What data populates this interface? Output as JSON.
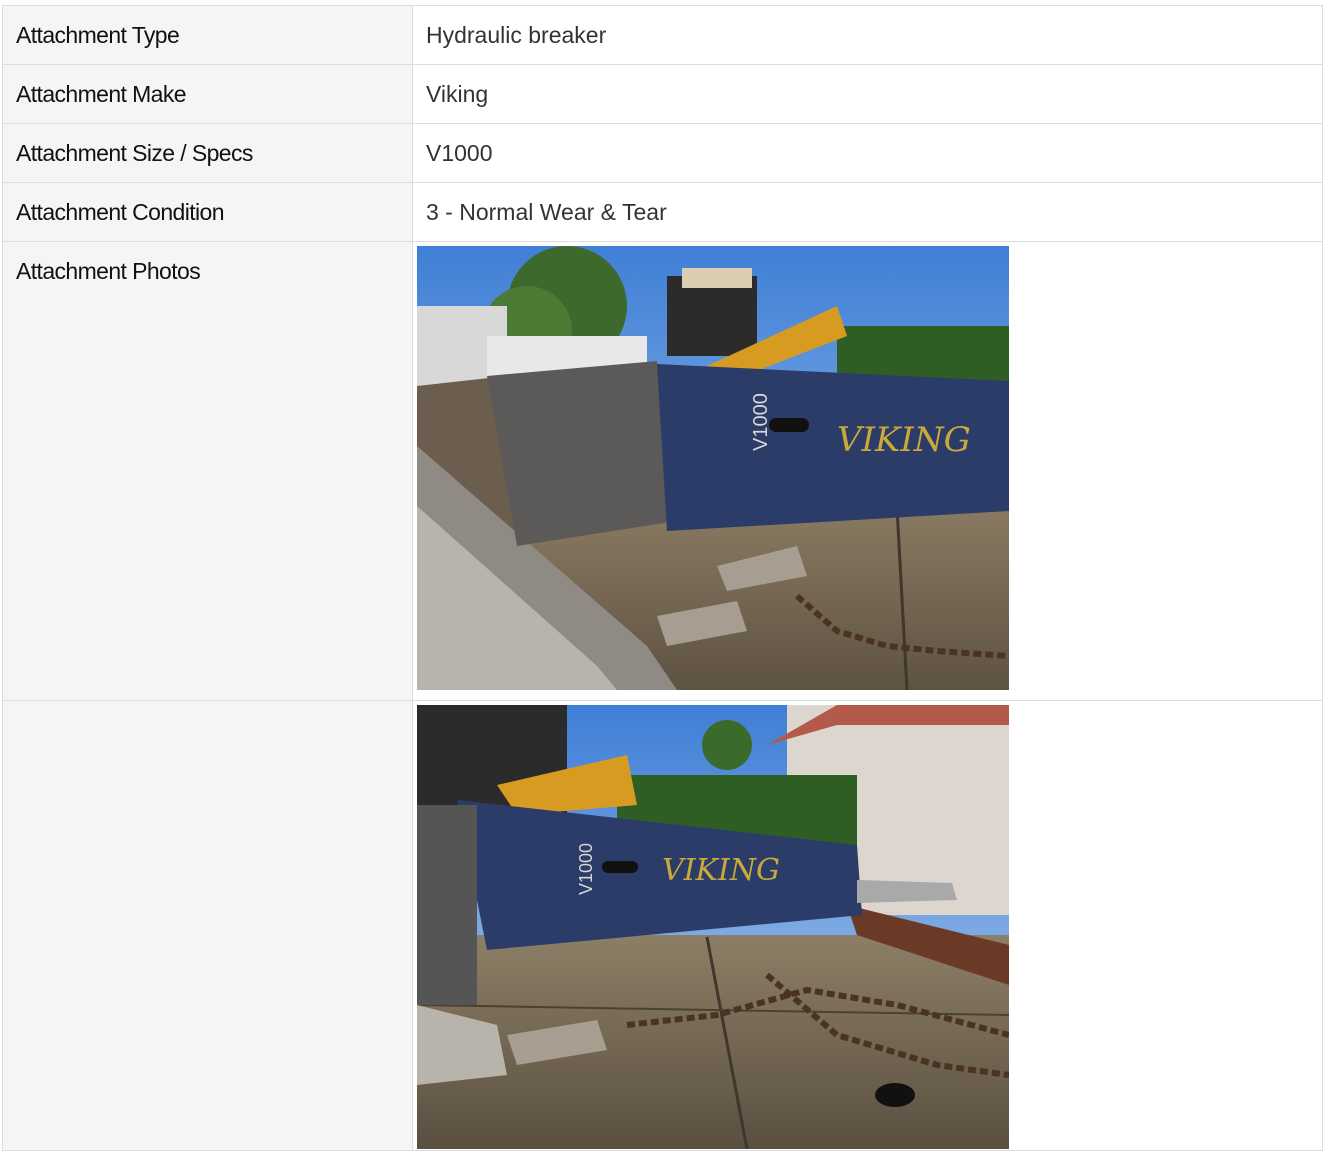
{
  "rows": [
    {
      "label": "Attachment Type",
      "value": "Hydraulic breaker"
    },
    {
      "label": "Attachment Make",
      "value": "Viking"
    },
    {
      "label": "Attachment Size / Specs",
      "value": "V1000"
    },
    {
      "label": "Attachment Condition",
      "value": "3 - Normal Wear & Tear"
    }
  ],
  "photos_row": {
    "label": "Attachment Photos",
    "photos": [
      {
        "brand_text": "VIKING",
        "model_text": "V1000"
      },
      {
        "brand_text": "VIKING",
        "model_text": "V1000"
      }
    ]
  },
  "colors": {
    "label_bg": "#f5f5f5",
    "border": "#dcdcdc",
    "breaker_blue": "#2c3c68",
    "logo_gold": "#c9a93a"
  }
}
